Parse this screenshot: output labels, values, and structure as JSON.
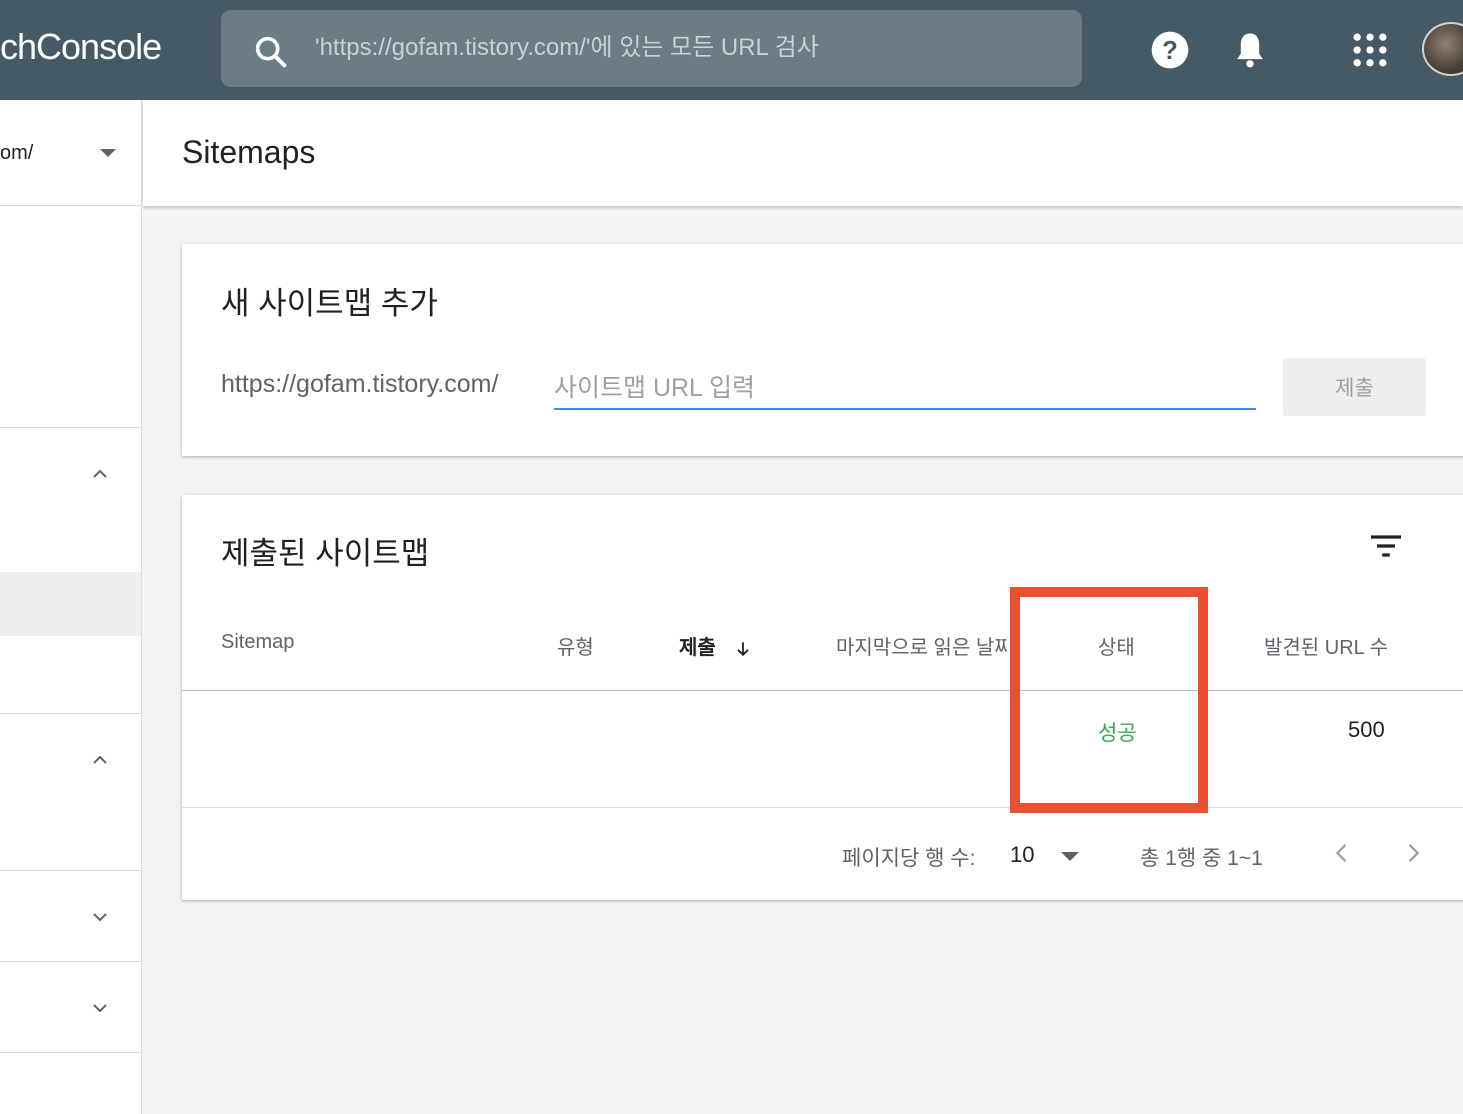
{
  "app": {
    "brand_text": "chConsole",
    "search": {
      "placeholder": "'https://gofam.tistory.com/'에 있는 모든 URL 검사"
    },
    "icons": [
      "search-icon",
      "help-icon",
      "notification-bell-icon",
      "apps-grid-icon",
      "account-avatar"
    ]
  },
  "sidebar": {
    "property": "om/",
    "sections": [
      "chevron-up",
      "chevron-up",
      "chevron-down",
      "chevron-down"
    ]
  },
  "header": {
    "title": "Sitemaps"
  },
  "add_sitemap": {
    "title": "새 사이트맵 추가",
    "url_prefix": "https://gofam.tistory.com/",
    "input_placeholder": "사이트맵 URL 입력",
    "submit_label": "제출"
  },
  "submitted": {
    "title": "제출된 사이트맵",
    "columns": {
      "sitemap": "Sitemap",
      "type": "유형",
      "submitted": "제출",
      "last_read": "마지막으로 읽은 날짜",
      "status": "상태",
      "found_urls": "발견된 URL 수"
    },
    "sort_column": "submitted",
    "rows": [
      {
        "sitemap": "",
        "type": "",
        "submitted": "",
        "last_read": "",
        "status": "성공",
        "found_urls": "500"
      }
    ],
    "pagination": {
      "rows_per_page_label": "페이지당 행 수:",
      "rows_per_page": "10",
      "range_text": "총 1행 중 1~1"
    }
  },
  "colors": {
    "topbar": "#455a64",
    "status_success": "#34a853",
    "input_underline": "#4285f4",
    "highlight_box": "#e8502f"
  }
}
